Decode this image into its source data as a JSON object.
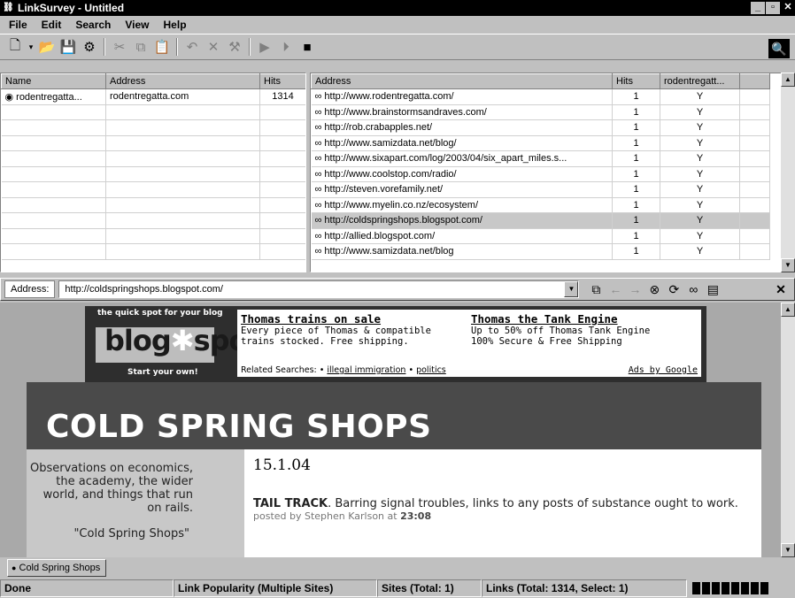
{
  "window": {
    "title": "LinkSurvey - Untitled",
    "buttons": [
      "_",
      "▫",
      "✕"
    ]
  },
  "menu": [
    "File",
    "Edit",
    "Search",
    "View",
    "Help"
  ],
  "left_table": {
    "columns": [
      "Name",
      "Address",
      "Hits"
    ],
    "rows": [
      {
        "name": "rodentregatta...",
        "address": "rodentregatta.com",
        "hits": "1314"
      }
    ]
  },
  "right_table": {
    "columns": [
      "Address",
      "Hits",
      "rodentregatt..."
    ],
    "rows": [
      {
        "address": "http://www.rodentregatta.com/",
        "hits": "1",
        "flag": "Y"
      },
      {
        "address": "http://www.brainstormsandraves.com/",
        "hits": "1",
        "flag": "Y"
      },
      {
        "address": "http://rob.crabapples.net/",
        "hits": "1",
        "flag": "Y"
      },
      {
        "address": "http://www.samizdata.net/blog/",
        "hits": "1",
        "flag": "Y"
      },
      {
        "address": "http://www.sixapart.com/log/2003/04/six_apart_miles.s...",
        "hits": "1",
        "flag": "Y"
      },
      {
        "address": "http://www.coolstop.com/radio/",
        "hits": "1",
        "flag": "Y"
      },
      {
        "address": "http://steven.vorefamily.net/",
        "hits": "1",
        "flag": "Y"
      },
      {
        "address": "http://www.myelin.co.nz/ecosystem/",
        "hits": "1",
        "flag": "Y"
      },
      {
        "address": "http://coldspringshops.blogspot.com/",
        "hits": "1",
        "flag": "Y",
        "selected": true
      },
      {
        "address": "http://allied.blogspot.com/",
        "hits": "1",
        "flag": "Y"
      },
      {
        "address": "http://www.samizdata.net/blog",
        "hits": "1",
        "flag": "Y"
      }
    ]
  },
  "address_bar": {
    "label": "Address:",
    "value": "http://coldspringshops.blogspot.com/"
  },
  "webpage": {
    "blogspot_tagline": "the quick spot for your blog",
    "blogspot_logo": "blog*spot",
    "blogspot_cta": "Start your own!",
    "ad1": {
      "title": "Thomas trains on sale",
      "line1": "Every piece of Thomas & compatible",
      "line2": "trains stocked. Free shipping."
    },
    "ad2": {
      "title": "Thomas the Tank Engine",
      "line1": "Up to 50% off Thomas Tank Engine",
      "line2": "100% Secure & Free Shipping"
    },
    "related_label": "Related Searches: •",
    "related_1": "illegal immigration",
    "related_sep": "•",
    "related_2": "politics",
    "ads_by": "Ads by Google",
    "site_title": "COLD SPRING SHOPS",
    "sidebar_text": "Observations on economics, the academy, the wider world, and things that run on rails.",
    "sidebar_quote": "\"Cold Spring Shops\"",
    "post_date": "15.1.04",
    "post_title": "TAIL TRACK",
    "post_text": ". Barring signal troubles, links to any posts of substance ought to work.",
    "post_meta_prefix": "posted by Stephen Karlson at ",
    "post_time": "23:08"
  },
  "tab": {
    "label": "Cold Spring Shops"
  },
  "status": {
    "state": "Done",
    "mode": "Link Popularity (Multiple Sites)",
    "sites": "Sites (Total: 1)",
    "links": "Links (Total: 1314, Select: 1)"
  }
}
